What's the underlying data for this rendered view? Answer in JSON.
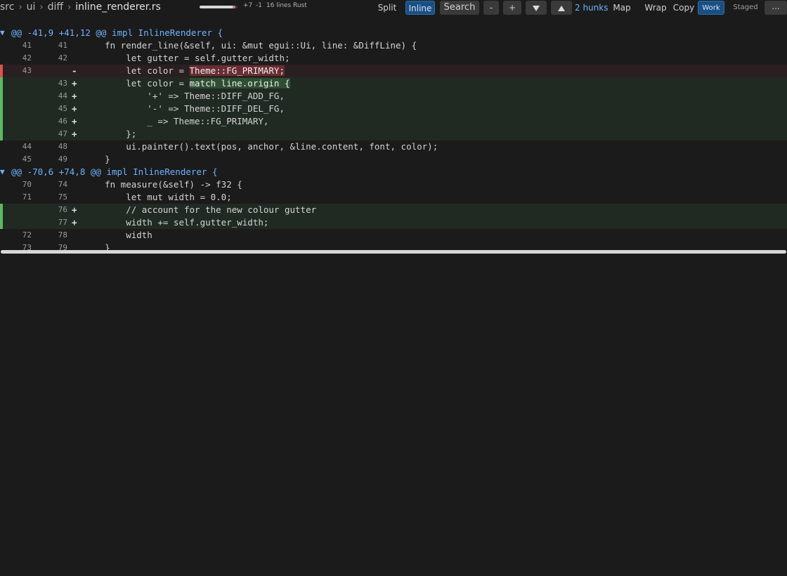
{
  "breadcrumb": {
    "parts": [
      "src",
      "ui",
      "diff"
    ],
    "file": "inline_renderer.rs",
    "separator": "›"
  },
  "stats": {
    "progress": 0.9,
    "added": "+7",
    "removed": "-1",
    "lines": "16 lines",
    "language": "Rust"
  },
  "toolbar": {
    "split": "Split",
    "inline": "Inline",
    "search": "Search",
    "collapse": "-",
    "expand": "+",
    "next_hunk_icon": "triangle-down-icon",
    "prev_hunk_icon": "triangle-up-icon",
    "hunks": "2 hunks",
    "map": "Map",
    "wrap": "Wrap",
    "copy": "Copy",
    "work": "Work",
    "staged": "Staged",
    "more": "..."
  },
  "colors": {
    "accent": "#6fb3ff",
    "add": "#5cb860",
    "del": "#d9534f",
    "selected": "#1b4f80"
  },
  "hunks": [
    {
      "arrow": "▼",
      "header": "@@ -41,9 +41,12 @@ impl InlineRenderer {",
      "lines": [
        {
          "type": "ctx",
          "old": "41",
          "new": "41",
          "sign": "",
          "code": "    fn render_line(&self, ui: &mut egui::Ui, line: &DiffLine) {"
        },
        {
          "type": "ctx",
          "old": "42",
          "new": "42",
          "sign": "",
          "code": "        let gutter = self.gutter_width;"
        },
        {
          "type": "del",
          "old": "43",
          "new": "",
          "sign": "-",
          "code": "        let color = ",
          "hl": "Theme::FG_PRIMARY;"
        },
        {
          "type": "add",
          "old": "",
          "new": "43",
          "sign": "+",
          "code": "        let color = ",
          "hl": "match line.origin {"
        },
        {
          "type": "add",
          "old": "",
          "new": "44",
          "sign": "+",
          "code": "            '+' => Theme::DIFF_ADD_FG,"
        },
        {
          "type": "add",
          "old": "",
          "new": "45",
          "sign": "+",
          "code": "            '-' => Theme::DIFF_DEL_FG,"
        },
        {
          "type": "add",
          "old": "",
          "new": "46",
          "sign": "+",
          "code": "            _ => Theme::FG_PRIMARY,"
        },
        {
          "type": "add",
          "old": "",
          "new": "47",
          "sign": "+",
          "code": "        };"
        },
        {
          "type": "ctx",
          "old": "44",
          "new": "48",
          "sign": "",
          "code": "        ui.painter().text(pos, anchor, &line.content, font, color);"
        },
        {
          "type": "ctx",
          "old": "45",
          "new": "49",
          "sign": "",
          "code": "    }"
        }
      ]
    },
    {
      "arrow": "▼",
      "header": "@@ -70,6 +74,8 @@ impl InlineRenderer {",
      "lines": [
        {
          "type": "ctx",
          "old": "70",
          "new": "74",
          "sign": "",
          "code": "    fn measure(&self) -> f32 {"
        },
        {
          "type": "ctx",
          "old": "71",
          "new": "75",
          "sign": "",
          "code": "        let mut width = 0.0;"
        },
        {
          "type": "add",
          "old": "",
          "new": "76",
          "sign": "+",
          "code": "        // account for the new colour gutter"
        },
        {
          "type": "add",
          "old": "",
          "new": "77",
          "sign": "+",
          "code": "        width += self.gutter_width;"
        },
        {
          "type": "ctx",
          "old": "72",
          "new": "78",
          "sign": "",
          "code": "        width"
        },
        {
          "type": "ctx",
          "old": "73",
          "new": "79",
          "sign": "",
          "code": "    }"
        }
      ]
    }
  ]
}
